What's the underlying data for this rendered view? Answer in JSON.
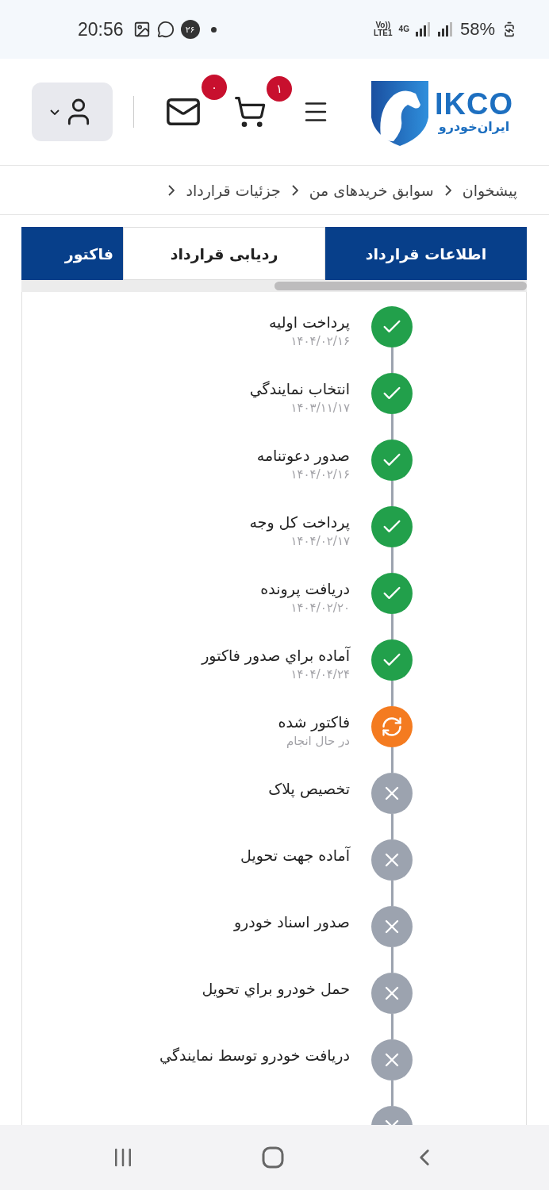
{
  "status_bar": {
    "time": "20:56",
    "notification_count": "۲۶",
    "volte": "Vo))",
    "lte": "LTE1",
    "network": "4G",
    "battery": "58%"
  },
  "header": {
    "logo": {
      "latin": "IKCO",
      "persian": "ایران‌خودرو"
    },
    "cart_count": "۱",
    "mail_count": "۰"
  },
  "breadcrumb": [
    "پیشخوان",
    "سوابق خریدهای من",
    "جزئیات قرارداد"
  ],
  "tabs": [
    {
      "label": "اطلاعات قرارداد",
      "selected": false
    },
    {
      "label": "ردیابی قرارداد",
      "selected": true
    },
    {
      "label": "فاکتور",
      "selected": false
    }
  ],
  "steps": [
    {
      "title": "پرداخت اولیه",
      "subtitle": "۱۴۰۴/۰۲/۱۶",
      "kind": "done"
    },
    {
      "title": "انتخاب نمايندگي",
      "subtitle": "۱۴۰۳/۱۱/۱۷",
      "kind": "done"
    },
    {
      "title": "صدور دعوتنامه",
      "subtitle": "۱۴۰۴/۰۲/۱۶",
      "kind": "done"
    },
    {
      "title": "پرداخت کل وجه",
      "subtitle": "۱۴۰۴/۰۲/۱۷",
      "kind": "done"
    },
    {
      "title": "دریافت پرونده",
      "subtitle": "۱۴۰۴/۰۲/۲۰",
      "kind": "done"
    },
    {
      "title": "آماده براي صدور فاکتور",
      "subtitle": "۱۴۰۴/۰۴/۲۴",
      "kind": "done"
    },
    {
      "title": "فاکتور شده",
      "subtitle": "در حال انجام",
      "kind": "in_progress"
    },
    {
      "title": "تخصیص پلاک",
      "kind": "pending"
    },
    {
      "title": "آماده جهت تحویل",
      "kind": "pending"
    },
    {
      "title": "صدور اسناد خودرو",
      "kind": "pending"
    },
    {
      "title": "حمل خودرو براي تحویل",
      "kind": "pending"
    },
    {
      "title": "دریافت خودرو توسط نمايندگي",
      "kind": "pending"
    },
    {
      "kind": "pending"
    }
  ]
}
